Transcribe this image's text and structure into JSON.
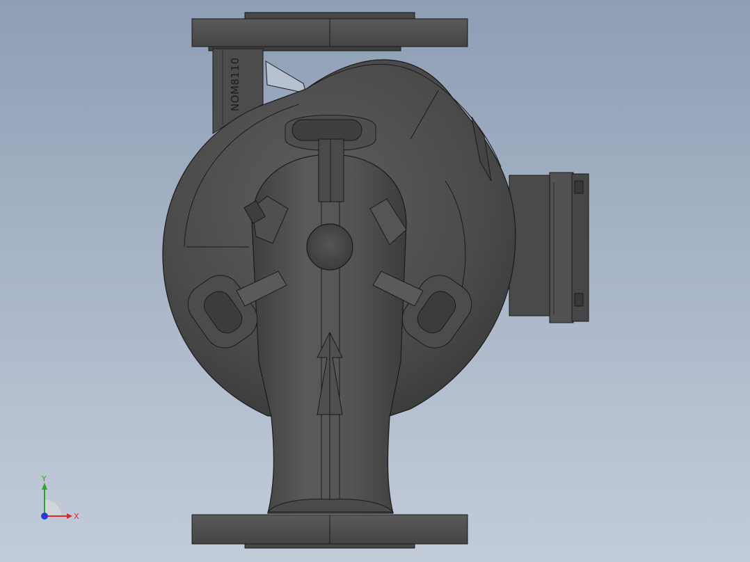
{
  "model": {
    "body_text": "NOM8110",
    "body_color": "#4d4d4d",
    "shade_color": "#3a3a3a",
    "highlight_color": "#6e6e6e",
    "edge_color": "#1a1a1a"
  },
  "triad": {
    "x_label": "X",
    "y_label": "Y",
    "x_color": "#d42a2a",
    "y_color": "#2aa52a",
    "z_color": "#2a3ad4"
  }
}
